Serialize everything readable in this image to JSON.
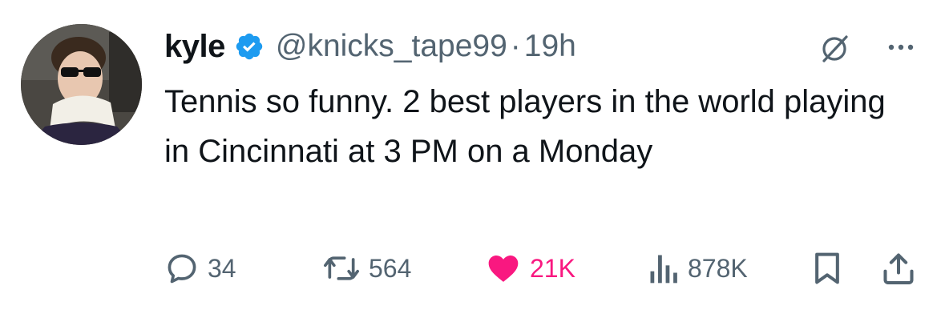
{
  "user": {
    "display_name": "kyle",
    "verified_icon": "verified-badge-icon",
    "handle": "@knicks_tape99",
    "separator": "·",
    "time": "19h"
  },
  "tweet": {
    "text": "Tennis so funny. 2 best players in the world playing in Cincinnati at 3 PM on a Monday"
  },
  "actions": {
    "replies": "34",
    "retweets": "564",
    "likes": "21K",
    "views": "878K"
  },
  "colors": {
    "verified": "#1d9bf0",
    "like": "#f91880",
    "muted": "#536471",
    "text": "#0f1419"
  }
}
